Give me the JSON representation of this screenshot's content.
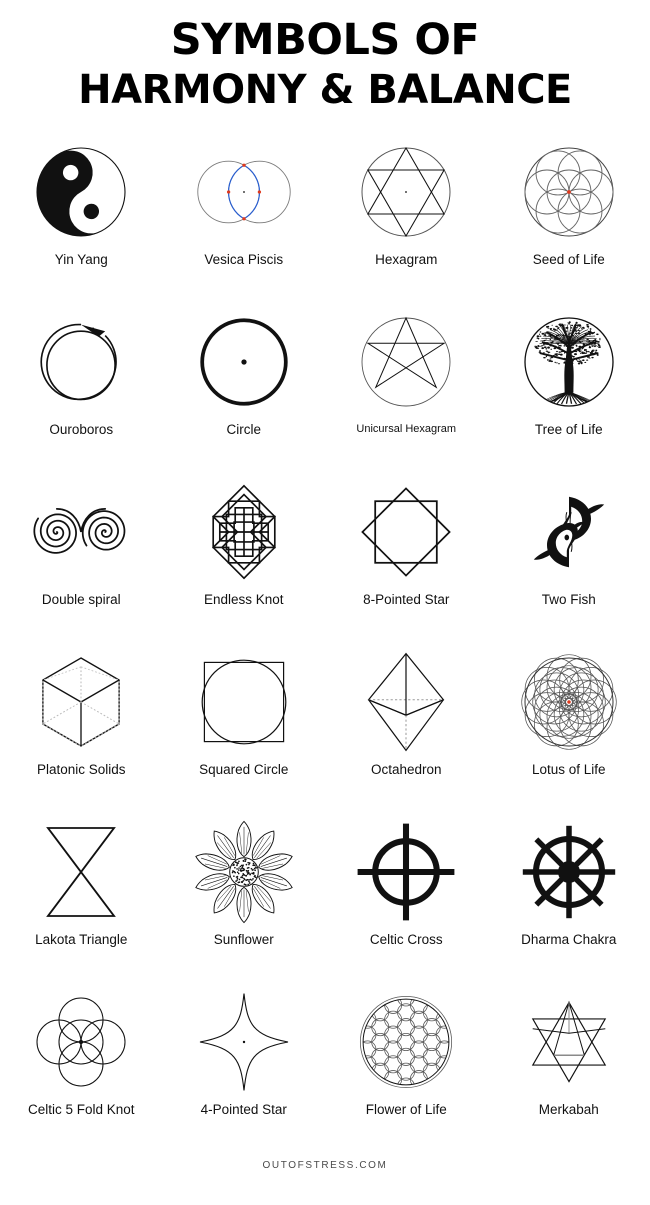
{
  "header": {
    "title_line_1": "SYMBOLS OF",
    "title_line_2": "HARMONY & BALANCE"
  },
  "footer": {
    "credit": "OUTOFSTRESS.COM"
  },
  "colors": {
    "ink": "#111111",
    "stroke_light": "#555555",
    "accent_red": "#e03a1e",
    "accent_blue": "#2a5fd0",
    "background": "#ffffff"
  },
  "grid": {
    "columns": 4,
    "rows": 6,
    "count": 24
  },
  "symbols": [
    {
      "label": "Yin Yang",
      "icon": "yin-yang-icon",
      "size": "normal"
    },
    {
      "label": "Vesica Piscis",
      "icon": "vesica-piscis-icon",
      "size": "normal"
    },
    {
      "label": "Hexagram",
      "icon": "hexagram-icon",
      "size": "normal"
    },
    {
      "label": "Seed of Life",
      "icon": "seed-of-life-icon",
      "size": "normal"
    },
    {
      "label": "Ouroboros",
      "icon": "ouroboros-icon",
      "size": "normal"
    },
    {
      "label": "Circle",
      "icon": "circle-icon",
      "size": "normal"
    },
    {
      "label": "Unicursal Hexagram",
      "icon": "unicursal-hexagram-icon",
      "size": "small"
    },
    {
      "label": "Tree of Life",
      "icon": "tree-of-life-icon",
      "size": "normal"
    },
    {
      "label": "Double spiral",
      "icon": "double-spiral-icon",
      "size": "normal"
    },
    {
      "label": "Endless Knot",
      "icon": "endless-knot-icon",
      "size": "normal"
    },
    {
      "label": "8-Pointed Star",
      "icon": "eight-pointed-star-icon",
      "size": "normal"
    },
    {
      "label": "Two Fish",
      "icon": "two-fish-icon",
      "size": "normal"
    },
    {
      "label": "Platonic Solids",
      "icon": "platonic-solids-icon",
      "size": "normal"
    },
    {
      "label": "Squared Circle",
      "icon": "squared-circle-icon",
      "size": "normal"
    },
    {
      "label": "Octahedron",
      "icon": "octahedron-icon",
      "size": "normal"
    },
    {
      "label": "Lotus of Life",
      "icon": "lotus-of-life-icon",
      "size": "normal"
    },
    {
      "label": "Lakota Triangle",
      "icon": "lakota-triangle-icon",
      "size": "normal"
    },
    {
      "label": "Sunflower",
      "icon": "sunflower-icon",
      "size": "normal"
    },
    {
      "label": "Celtic Cross",
      "icon": "celtic-cross-icon",
      "size": "normal"
    },
    {
      "label": "Dharma Chakra",
      "icon": "dharma-chakra-icon",
      "size": "normal"
    },
    {
      "label": "Celtic 5 Fold Knot",
      "icon": "celtic-5-fold-knot-icon",
      "size": "normal"
    },
    {
      "label": "4-Pointed Star",
      "icon": "four-pointed-star-icon",
      "size": "normal"
    },
    {
      "label": "Flower of Life",
      "icon": "flower-of-life-icon",
      "size": "normal"
    },
    {
      "label": "Merkabah",
      "icon": "merkabah-icon",
      "size": "normal"
    }
  ]
}
